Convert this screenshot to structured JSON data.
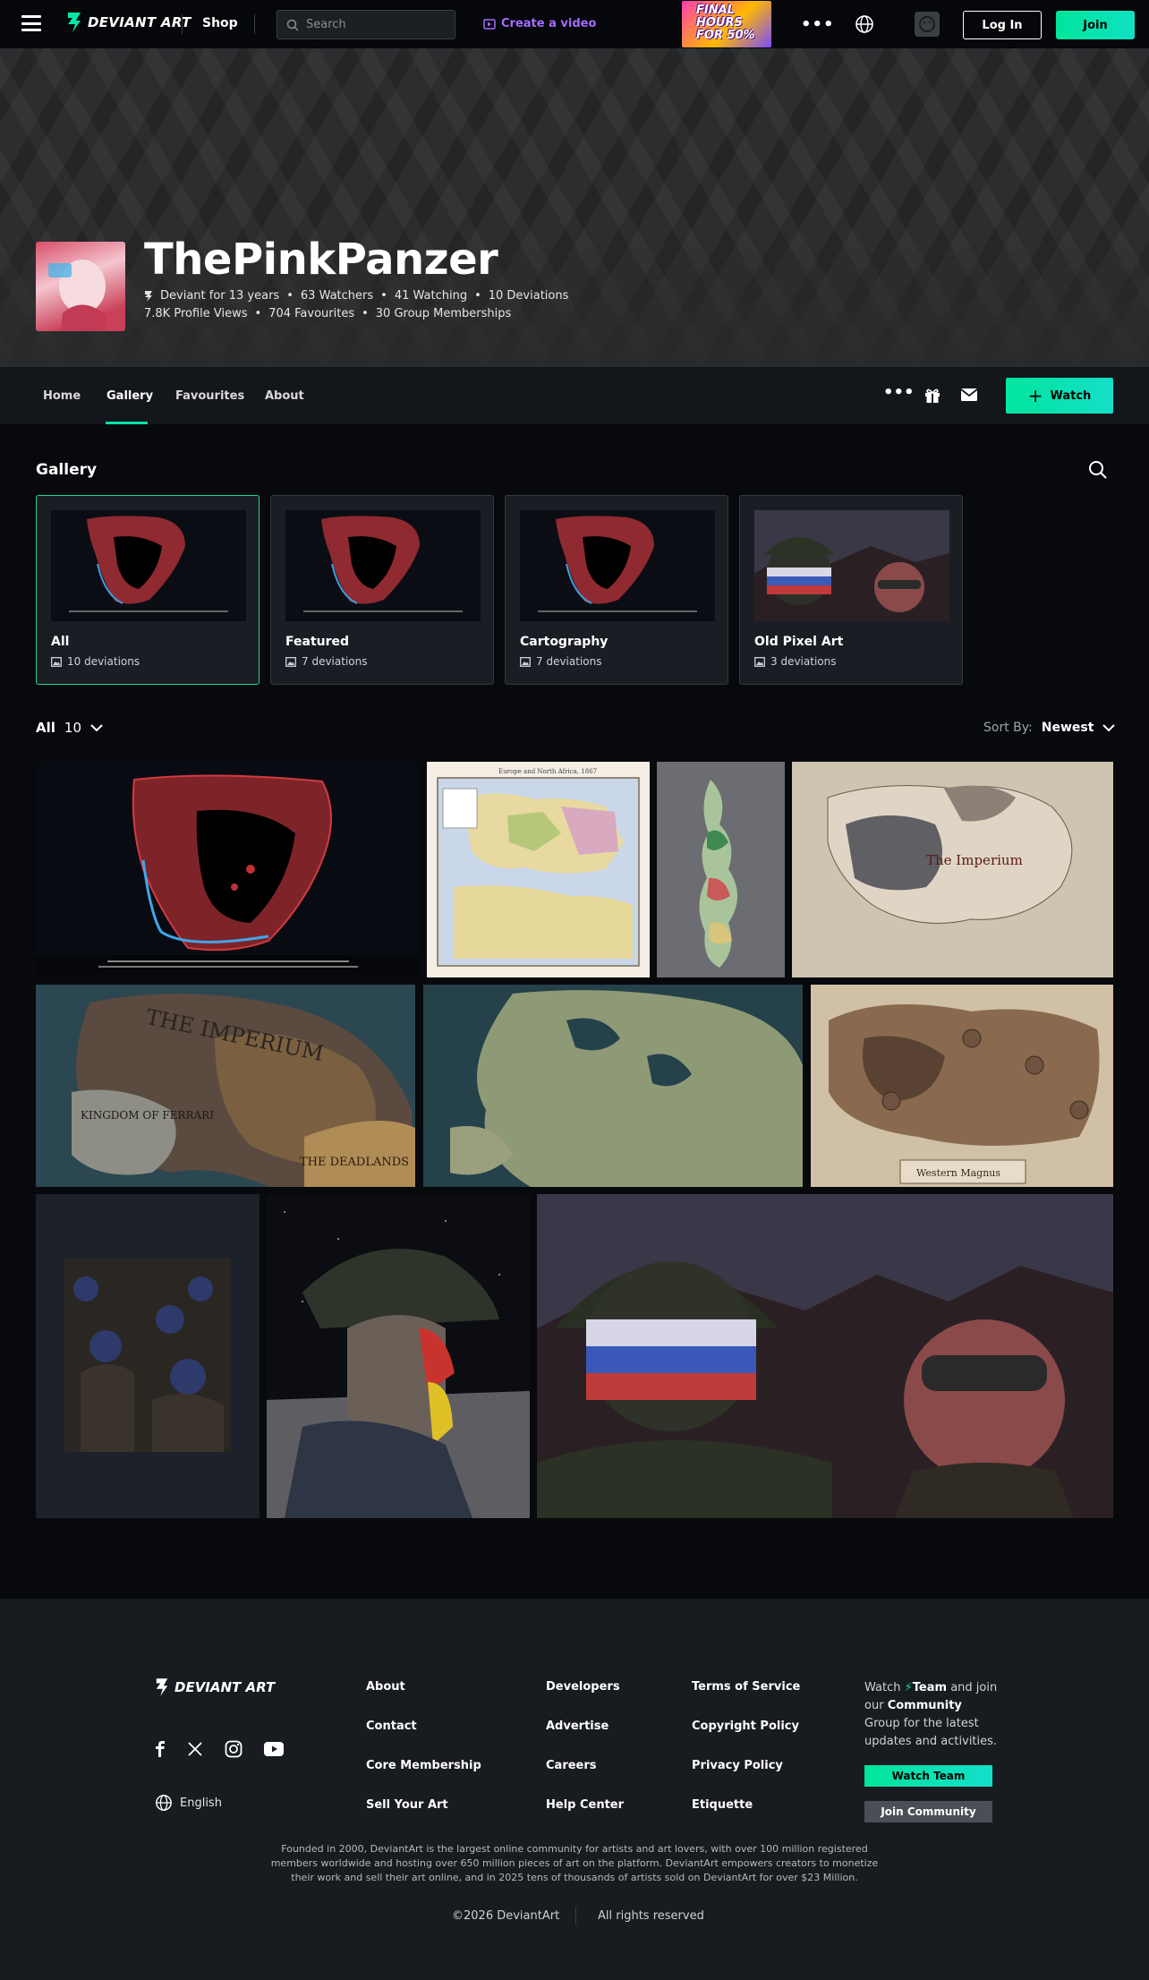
{
  "header": {
    "logo_text": "DEVIANT ART",
    "shop_label": "Shop",
    "search_placeholder": "Search",
    "create_label": "Create a video",
    "promo_text": "FINAL HOURS FOR 50%",
    "login_label": "Log In",
    "join_label": "Join"
  },
  "profile": {
    "username": "ThePinkPanzer",
    "stats_line1": [
      "Deviant for 13 years",
      "63 Watchers",
      "41 Watching",
      "10 Deviations"
    ],
    "stats_line2": [
      "7.8K Profile Views",
      "704 Favourites",
      "30 Group Memberships"
    ]
  },
  "tabs": [
    {
      "label": "Home",
      "active": false
    },
    {
      "label": "Gallery",
      "active": true
    },
    {
      "label": "Favourites",
      "active": false
    },
    {
      "label": "About",
      "active": false
    }
  ],
  "watch_label": "Watch",
  "gallery": {
    "title": "Gallery",
    "folders": [
      {
        "name": "All",
        "count": "10 deviations",
        "selected": true
      },
      {
        "name": "Featured",
        "count": "7 deviations",
        "selected": false
      },
      {
        "name": "Cartography",
        "count": "7 deviations",
        "selected": false
      },
      {
        "name": "Old Pixel Art",
        "count": "3 deviations",
        "selected": false
      }
    ],
    "filter_label": "All",
    "filter_count": "10",
    "sort_label": "Sort By:",
    "sort_value": "Newest"
  },
  "artwork_labels": {
    "map_title": "Europe and North Africa, 1867",
    "imperium": "The Imperium",
    "deadlands": "THE DEADLANDS",
    "imperium_big": "THE IMPERIUM",
    "kingdom": "KINGDOM OF FERRARI",
    "magnus": "Western Magnus"
  },
  "footer": {
    "logo_text": "DEVIANT ART",
    "language": "English",
    "col1": [
      "About",
      "Contact",
      "Core Membership",
      "Sell Your Art"
    ],
    "col2": [
      "Developers",
      "Advertise",
      "Careers",
      "Help Center"
    ],
    "col3": [
      "Terms of Service",
      "Copyright Policy",
      "Privacy Policy",
      "Etiquette"
    ],
    "watch_prefix": "Watch",
    "watch_team": "Team",
    "watch_mid": "and join our",
    "watch_community": "Community",
    "watch_suffix": "Group for the latest updates and activities.",
    "watch_team_btn": "Watch Team",
    "join_community_btn": "Join Community",
    "about_text": "Founded in 2000, DeviantArt is the largest online community for artists and art lovers, with over 100 million registered members worldwide and hosting over 650 million pieces of art on the platform. DeviantArt empowers creators to monetize their work and sell their art online, and in 2025 tens of thousands of artists sold on DeviantArt for over $23 Million.",
    "copyright": "©2026 DeviantArt",
    "rights": "All rights reserved"
  },
  "colors": {
    "accent": "#05e6a8",
    "create_purple": "#a46cff",
    "page_bg": "#07090d",
    "tabbar_bg": "#13161b",
    "footer_bg": "#181b20"
  }
}
